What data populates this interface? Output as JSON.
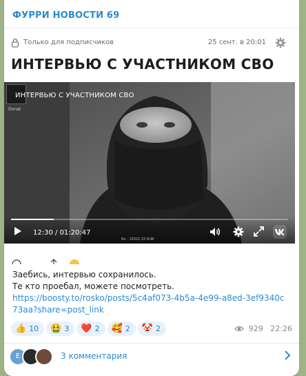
{
  "channel": {
    "name": "ФУРРИ НОВОСТИ 69"
  },
  "post": {
    "subscribers_label": "Только для подписчиков",
    "date": "25 сент. в 20:01",
    "title": "ИНТЕРВЬЮ С УЧАСТНИКОМ СВО",
    "video": {
      "caption": "ИНТЕРВЬЮ С УЧАСТНИКОМ СВО",
      "qr_label": "Donat",
      "current_time": "12:30",
      "duration": "01:20:47",
      "progress": 0.155,
      "tiny_caption": "Nv · 19321.33 RUB"
    }
  },
  "message": {
    "line1": "Заебись, интервью сохранилось.",
    "line2": "Те кто проебал, можете посмотреть.",
    "link": "https://boosty.to/rosko/posts/5c4af073-4b5a-4e99-a8ed-3ef9340c73aa?share=post_link"
  },
  "reactions": [
    {
      "emoji": "👍",
      "count": "10"
    },
    {
      "emoji": "🤮",
      "count": "3"
    },
    {
      "emoji": "❤️",
      "count": "2"
    },
    {
      "emoji": "🥰",
      "count": "2"
    },
    {
      "emoji": "🤡",
      "count": "2"
    }
  ],
  "meta": {
    "views": "929",
    "time": "22:26"
  },
  "comments": {
    "label": "3 комментария",
    "avatar_letter": "E"
  },
  "colors": {
    "accent": "#2b8bd0",
    "background": "#9fb486"
  }
}
